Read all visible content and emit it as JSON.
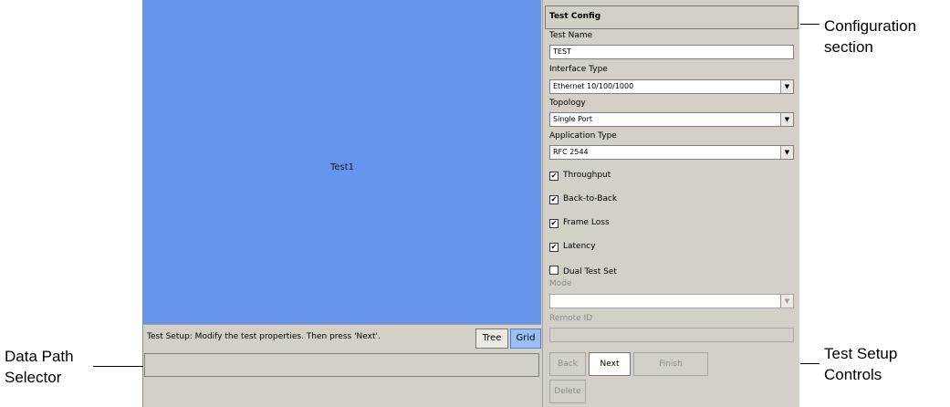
{
  "canvas": {
    "node_label": "Test1"
  },
  "status": {
    "text": "Test Setup: Modify the test properties. Then press 'Next'.",
    "tabs": [
      {
        "label": "Tree"
      },
      {
        "label": "Grid"
      }
    ]
  },
  "config": {
    "header": "Test Config",
    "test_name_label": "Test Name",
    "test_name_value": "TEST",
    "interface_type_label": "Interface Type",
    "interface_type_value": "Ethernet 10/100/1000",
    "topology_label": "Topology",
    "topology_value": "Single Port",
    "application_type_label": "Application Type",
    "application_type_value": "RFC 2544",
    "checkboxes": [
      {
        "label": "Throughput",
        "checked": true
      },
      {
        "label": "Back-to-Back",
        "checked": true
      },
      {
        "label": "Frame Loss",
        "checked": true
      },
      {
        "label": "Latency",
        "checked": true
      },
      {
        "label": "Dual Test Set",
        "checked": false
      }
    ],
    "mode_label": "Mode",
    "mode_value": "",
    "remote_id_label": "Remote ID",
    "remote_id_value": ""
  },
  "controls": {
    "back": "Back",
    "next": "Next",
    "finish": "Finish",
    "delete": "Delete"
  },
  "callouts": {
    "configuration_line1": "Configuration",
    "configuration_line2": "section",
    "test_setup_line1": "Test Setup",
    "test_setup_line2": "Controls",
    "data_path_line1": "Data Path",
    "data_path_line2": "Selector"
  },
  "glyphs": {
    "dropdown_arrow": "▼",
    "check": "✔"
  }
}
